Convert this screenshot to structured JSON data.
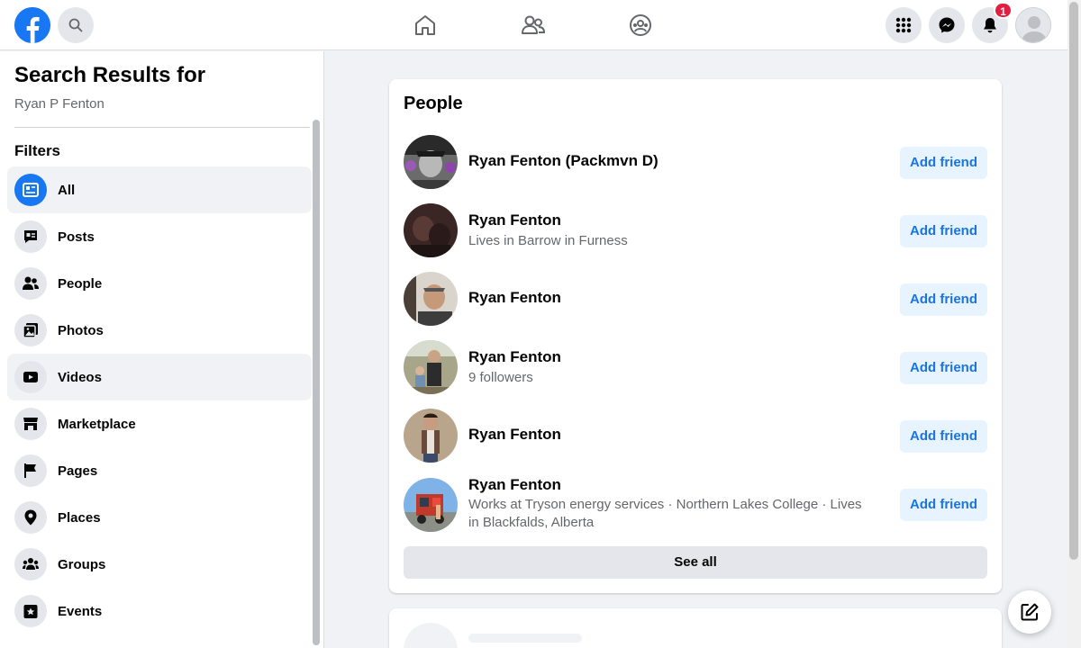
{
  "topbar": {
    "notifications_count": "1",
    "icons": [
      "facebook-logo",
      "search-icon",
      "home-icon",
      "friends-icon",
      "groups-icon",
      "menu-grid-icon",
      "messenger-icon",
      "bell-icon",
      "profile-avatar"
    ]
  },
  "sidebar": {
    "title": "Search Results for",
    "query": "Ryan P Fenton",
    "filters_label": "Filters",
    "items": [
      {
        "label": "All",
        "icon": "all-results-icon",
        "active": true
      },
      {
        "label": "Posts",
        "icon": "posts-icon"
      },
      {
        "label": "People",
        "icon": "people-icon"
      },
      {
        "label": "Photos",
        "icon": "photos-icon"
      },
      {
        "label": "Videos",
        "icon": "videos-icon",
        "hover": true
      },
      {
        "label": "Marketplace",
        "icon": "marketplace-icon"
      },
      {
        "label": "Pages",
        "icon": "pages-flag-icon"
      },
      {
        "label": "Places",
        "icon": "places-pin-icon"
      },
      {
        "label": "Groups",
        "icon": "groups-icon"
      },
      {
        "label": "Events",
        "icon": "events-icon"
      }
    ]
  },
  "people": {
    "title": "People",
    "add_label": "Add friend",
    "see_all": "See all",
    "results": [
      {
        "name": "Ryan Fenton (Packmvn D)",
        "sub": ""
      },
      {
        "name": "Ryan Fenton",
        "sub": "Lives in Barrow in Furness"
      },
      {
        "name": "Ryan Fenton",
        "sub": ""
      },
      {
        "name": "Ryan Fenton",
        "sub": "9 followers"
      },
      {
        "name": "Ryan Fenton",
        "sub": ""
      },
      {
        "name": "Ryan Fenton",
        "sub": "Works at Tryson energy services · Northern Lakes College · Lives in Blackfalds, Alberta"
      }
    ]
  },
  "colors": {
    "brand": "#1877f2",
    "button_bg": "#e7f3ff",
    "button_text": "#1b74e4",
    "badge": "#e41e3f"
  }
}
